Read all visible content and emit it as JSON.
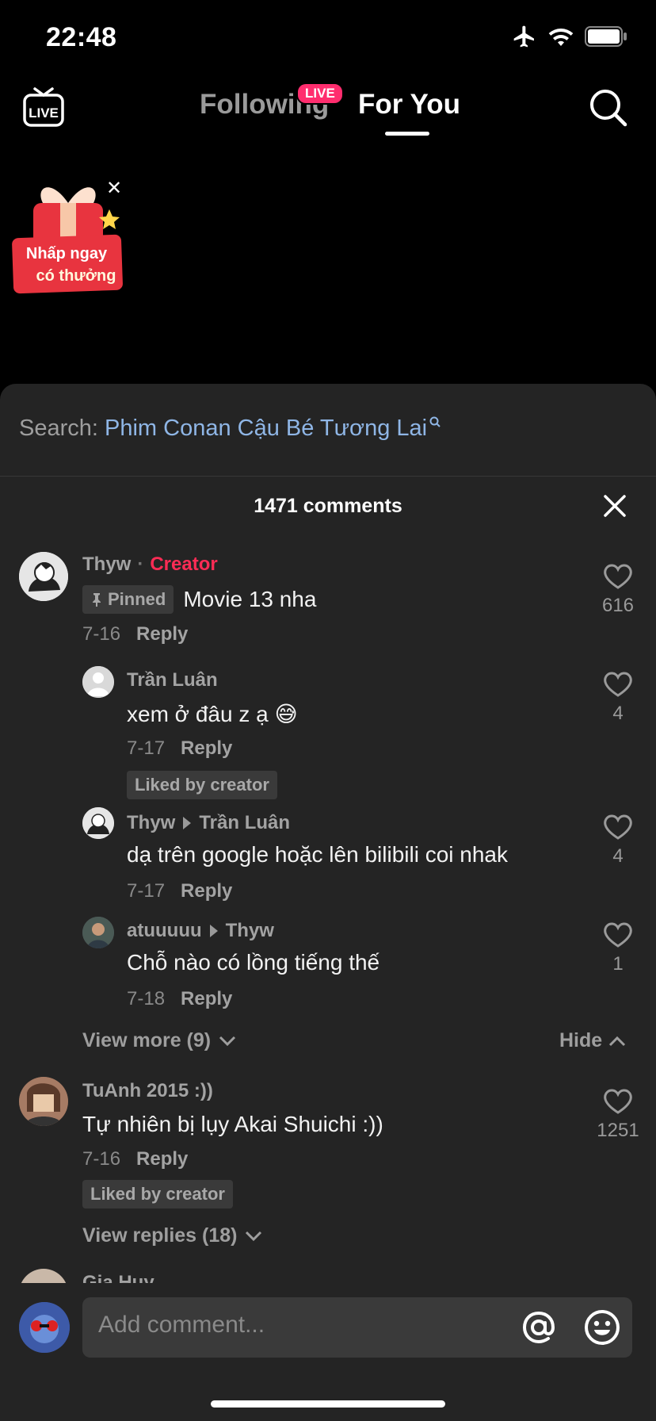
{
  "status_bar": {
    "time": "22:48"
  },
  "nav": {
    "live_label": "LIVE",
    "following": "Following",
    "following_badge": "LIVE",
    "for_you": "For You"
  },
  "promo": {
    "line1": "Nhấp ngay",
    "line2": "có thưởng"
  },
  "sheet": {
    "search_label": "Search:",
    "search_query": "Phim Conan Cậu Bé Tương Lai",
    "comment_count": "1471 comments"
  },
  "comments": {
    "c1": {
      "user": "Thyw",
      "role": "Creator",
      "pinned": "Pinned",
      "text": "Movie 13 nha",
      "date": "7-16",
      "reply": "Reply",
      "likes": "616"
    },
    "r1": {
      "user": "Trần Luân",
      "text": "xem ở đâu z ạ 😅",
      "date": "7-17",
      "reply": "Reply",
      "likes": "4",
      "badge": "Liked by creator"
    },
    "r2": {
      "user": "Thyw",
      "to": "Trần Luân",
      "text": "dạ trên google hoặc lên bilibili coi nhak",
      "date": "7-17",
      "reply": "Reply",
      "likes": "4"
    },
    "r3": {
      "user": "atuuuuu",
      "to": "Thyw",
      "text": "Chỗ nào có lồng tiếng thế",
      "date": "7-18",
      "reply": "Reply",
      "likes": "1"
    },
    "view_more": "View more (9)",
    "hide": "Hide",
    "c2": {
      "user": "TuAnh 2015 :))",
      "text": "Tự nhiên bị lụy Akai Shuichi :))",
      "date": "7-16",
      "reply": "Reply",
      "likes": "1251",
      "badge": "Liked by creator"
    },
    "view_replies": "View replies (18)",
    "c3": {
      "user": "Gia Huy"
    }
  },
  "composer": {
    "placeholder": "Add comment..."
  },
  "colors": {
    "accent": "#fe2c55",
    "sheet_bg": "#242424",
    "link_blue": "#8fb6e6"
  }
}
